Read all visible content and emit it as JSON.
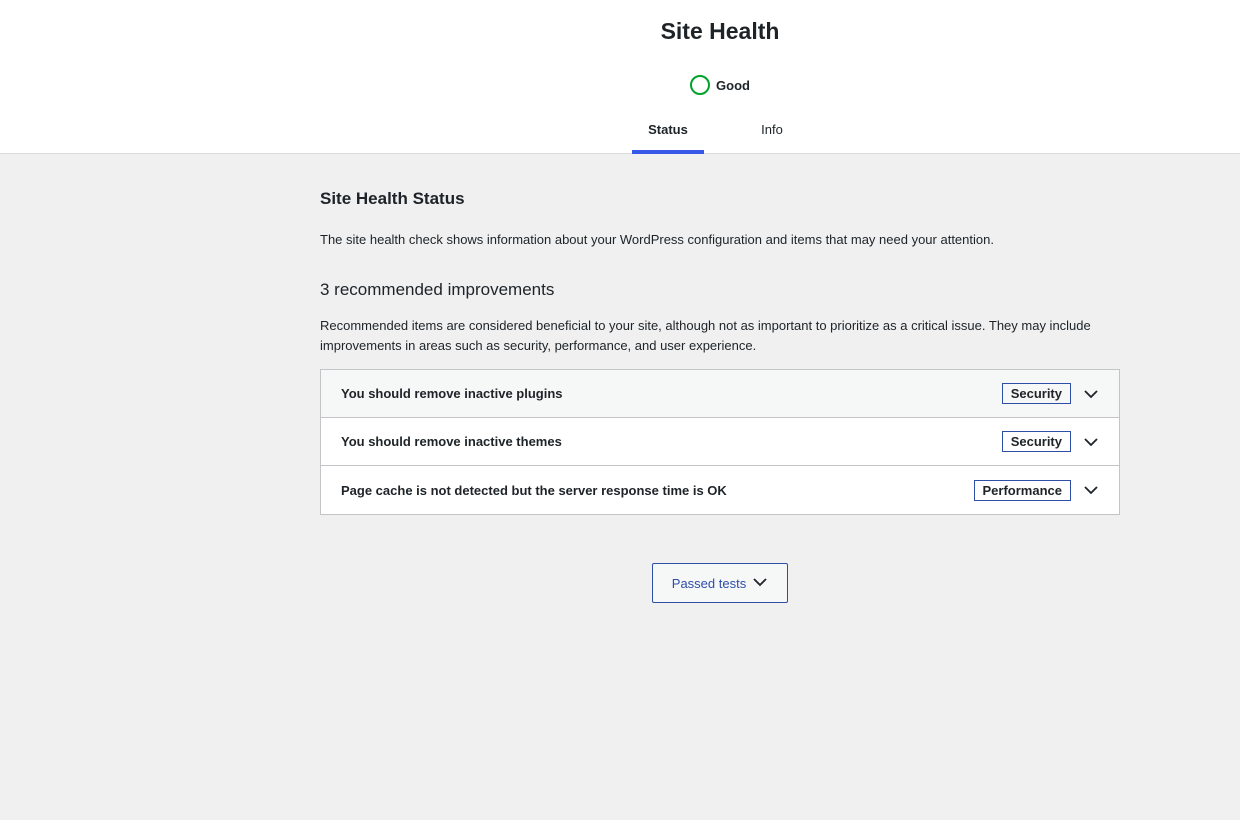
{
  "header": {
    "title": "Site Health",
    "status_label": "Good",
    "status_color": "#00a32a",
    "tabs": [
      {
        "label": "Status",
        "active": true
      },
      {
        "label": "Info",
        "active": false
      }
    ]
  },
  "main": {
    "section_title": "Site Health Status",
    "description": "The site health check shows information about your WordPress configuration and items that may need your attention.",
    "recommended_title": "3 recommended improvements",
    "recommended_description": "Recommended items are considered beneficial to your site, although not as important to prioritize as a critical issue. They may include improvements in areas such as security, performance, and user experience.",
    "items": [
      {
        "label": "You should remove inactive plugins",
        "badge": "Security"
      },
      {
        "label": "You should remove inactive themes",
        "badge": "Security"
      },
      {
        "label": "Page cache is not detected but the server response time is OK",
        "badge": "Performance"
      }
    ],
    "passed_tests_label": "Passed tests",
    "accent_color": "#3858e9"
  }
}
